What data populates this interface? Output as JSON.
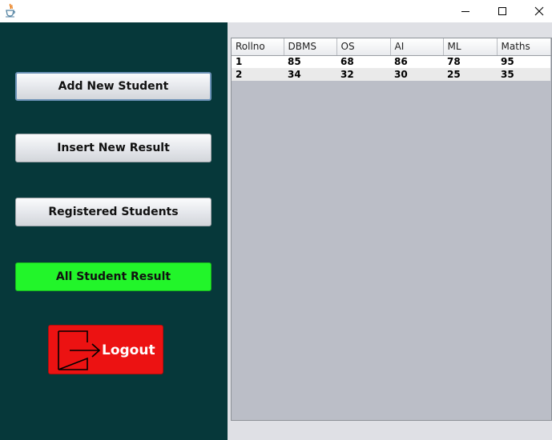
{
  "titlebar": {
    "app_icon": "java-coffee-cup-icon",
    "minimize_icon": "minimize-icon",
    "maximize_icon": "maximize-icon",
    "close_icon": "close-icon"
  },
  "sidebar": {
    "buttons": [
      {
        "label": "Add New Student",
        "focused": true
      },
      {
        "label": "Insert New Result"
      },
      {
        "label": "Registered Students"
      },
      {
        "label": "All Student Result",
        "active": true,
        "color": "#22f52a"
      }
    ],
    "logout": {
      "label": "Logout",
      "color": "#ec1212",
      "icon": "logout-arrow-icon"
    }
  },
  "results_table": {
    "columns": [
      "Rollno",
      "DBMS",
      "OS",
      "AI",
      "ML",
      "Maths"
    ],
    "rows": [
      [
        "1",
        "85",
        "68",
        "86",
        "78",
        "95"
      ],
      [
        "2",
        "34",
        "32",
        "30",
        "25",
        "35"
      ]
    ]
  },
  "colors": {
    "sidebar_bg": "#06383a",
    "active_button": "#22f52a",
    "logout_button": "#ec1212",
    "table_bg": "#bbbec7"
  }
}
